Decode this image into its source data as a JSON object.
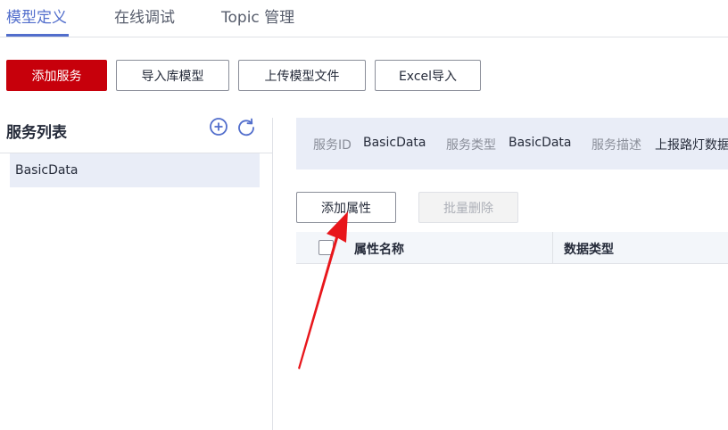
{
  "tabs": [
    {
      "label": "模型定义",
      "active": true
    },
    {
      "label": "在线调试",
      "active": false
    },
    {
      "label": "Topic 管理",
      "active": false
    }
  ],
  "toolbar": {
    "add_service": "添加服务",
    "import_library_model": "导入库模型",
    "upload_model_file": "上传模型文件",
    "excel_import": "Excel导入"
  },
  "service_list": {
    "title": "服务列表",
    "icons": [
      "add-circle-icon",
      "refresh-icon"
    ],
    "items": [
      "BasicData"
    ]
  },
  "service_info": {
    "id_label": "服务ID",
    "id_value": "BasicData",
    "type_label": "服务类型",
    "type_value": "BasicData",
    "desc_label": "服务描述",
    "desc_value": "上报路灯数据"
  },
  "property_actions": {
    "add_property": "添加属性",
    "batch_delete": "批量删除"
  },
  "table": {
    "columns": [
      "属性名称",
      "数据类型"
    ]
  },
  "colors": {
    "primary": "#c7000b",
    "tab_active": "#526ecc",
    "panel_bg": "#e9edf7",
    "annotation_arrow": "#e8161b"
  }
}
